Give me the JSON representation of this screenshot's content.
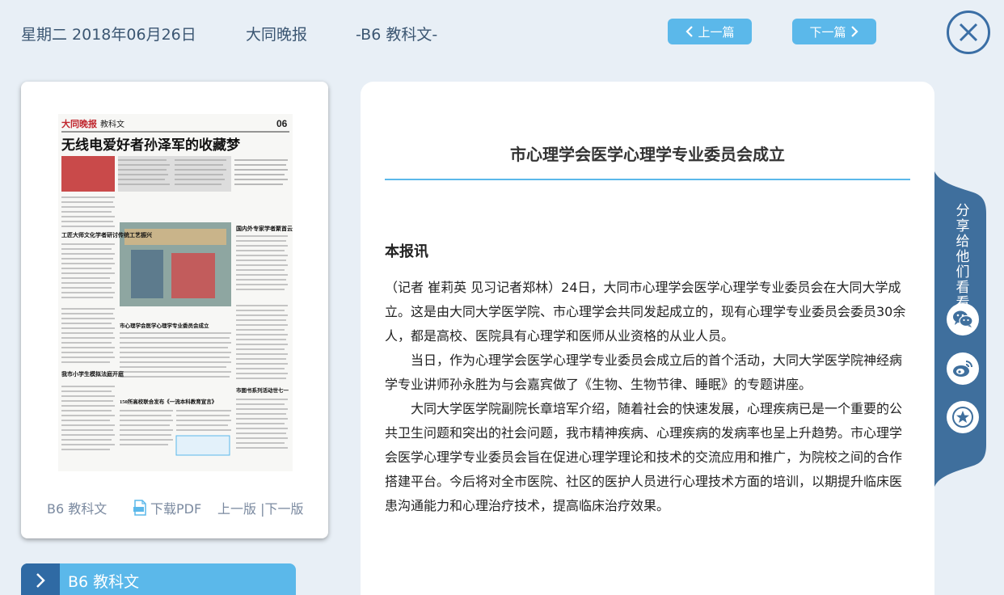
{
  "header": {
    "date": "星期二 2018年06月26日",
    "paper_name": "大同晚报",
    "section": "-B6 教科文-",
    "prev_label": "上一篇",
    "next_label": "下一篇",
    "close_icon": "close-icon"
  },
  "thumbnail": {
    "masthead": "大同晚报",
    "column": "教科文",
    "page_no": "06",
    "headline": "无线电爱好者孙泽军的收藏梦",
    "sub1": "工匠大师文化学者研讨传统工艺振兴",
    "sub2": "市心理学会医学心理学专业委员会成立",
    "sub3": "150所高校联合发布《一流本科教育宣言》",
    "sub4": "国内外专家学者聚首云冈进行文化研讨",
    "sub5": "我市小学生模拟法庭开庭",
    "sub6": "市图书系列活动世七一",
    "footer_edition": "B6 教科文",
    "footer_pdf": "下载PDF",
    "footer_pages": "上一版 |下一版"
  },
  "section_tab": {
    "label": "B6 教科文"
  },
  "article": {
    "title": "市心理学会医学心理学专业委员会成立",
    "byline": "本报讯",
    "paragraphs": [
      "（记者 崔莉英 见习记者郑林）24日，大同市心理学会医学心理学专业委员会在大同大学成立。这是由大同大学医学院、市心理学会共同发起成立的，现有心理学专业委员会委员30余人，都是高校、医院具有心理学和医师从业资格的从业人员。",
      "当日，作为心理学会医学心理学专业委员会成立后的首个活动，大同大学医学院神经病学专业讲师孙永胜为与会嘉宾做了《生物、生物节律、睡眠》的专题讲座。",
      "大同大学医学院副院长章培军介绍，随着社会的快速发展，心理疾病已是一个重要的公共卫生问题和突出的社会问题，我市精神疾病、心理疾病的发病率也呈上升趋势。市心理学会医学心理学专业委员会旨在促进心理学理论和技术的交流应用和推广，为院校之间的合作搭建平台。今后将对全市医院、社区的医护人员进行心理技术方面的培训，以期提升临床医患沟通能力和心理治疗技术，提高临床治疗效果。"
    ]
  },
  "share": {
    "label": "分享给他们看看",
    "icons": [
      "wechat-icon",
      "weibo-icon",
      "favorite-icon"
    ]
  },
  "colors": {
    "accent": "#5bb8ea",
    "dark_accent": "#2f6aa4",
    "background": "#e8eff6"
  }
}
